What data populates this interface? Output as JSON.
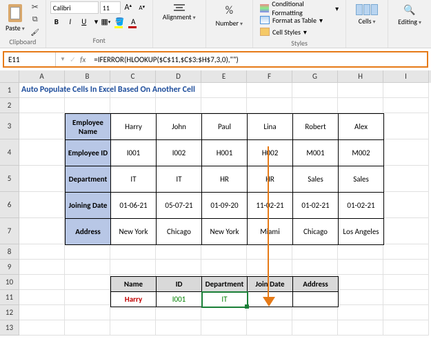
{
  "ribbon": {
    "clipboard": {
      "label": "Clipboard",
      "paste": "Paste"
    },
    "font": {
      "label": "Font",
      "name": "Calibri",
      "size": "11",
      "bold": "B",
      "italic": "I",
      "underline": "U"
    },
    "alignment": {
      "label": "Alignment"
    },
    "number": {
      "label": "Number"
    },
    "styles": {
      "label": "Styles",
      "conditional": "Conditional Formatting",
      "table": "Format as Table",
      "cell": "Cell Styles"
    },
    "cells": {
      "label": "Cells"
    },
    "editing": {
      "label": "Editing"
    }
  },
  "formula_bar": {
    "name_box": "E11",
    "formula": "=IFERROR(HLOOKUP($C$11,$C$3:$H$7,3,0),\"\")"
  },
  "sheet": {
    "title": "Auto Populate Cells In Excel Based On Another Cell",
    "columns": [
      "A",
      "B",
      "C",
      "D",
      "E",
      "F",
      "G",
      "H",
      "I"
    ],
    "rows": [
      "1",
      "2",
      "3",
      "4",
      "5",
      "6",
      "7",
      "8",
      "9",
      "10",
      "11",
      "12",
      "13"
    ],
    "main_table": {
      "row_headers": [
        "Employee Name",
        "Employee ID",
        "Department",
        "Joining Date",
        "Address"
      ],
      "data": [
        [
          "Harry",
          "John",
          "Paul",
          "Lina",
          "Robert",
          "Alex"
        ],
        [
          "I001",
          "I002",
          "H001",
          "H002",
          "M001",
          "M002"
        ],
        [
          "IT",
          "IT",
          "HR",
          "HR",
          "Sales",
          "Sales"
        ],
        [
          "01-06-21",
          "05-07-21",
          "01-09-20",
          "11-02-21",
          "01-02-21",
          "01-02-21"
        ],
        [
          "New York",
          "Chicago",
          "New York",
          "Miami",
          "Chicago",
          "Los Angeles"
        ]
      ]
    },
    "lookup_table": {
      "headers": [
        "Name",
        "ID",
        "Department",
        "Join Date",
        "Address"
      ],
      "row": [
        "Harry",
        "I001",
        "IT",
        "",
        ""
      ]
    }
  }
}
